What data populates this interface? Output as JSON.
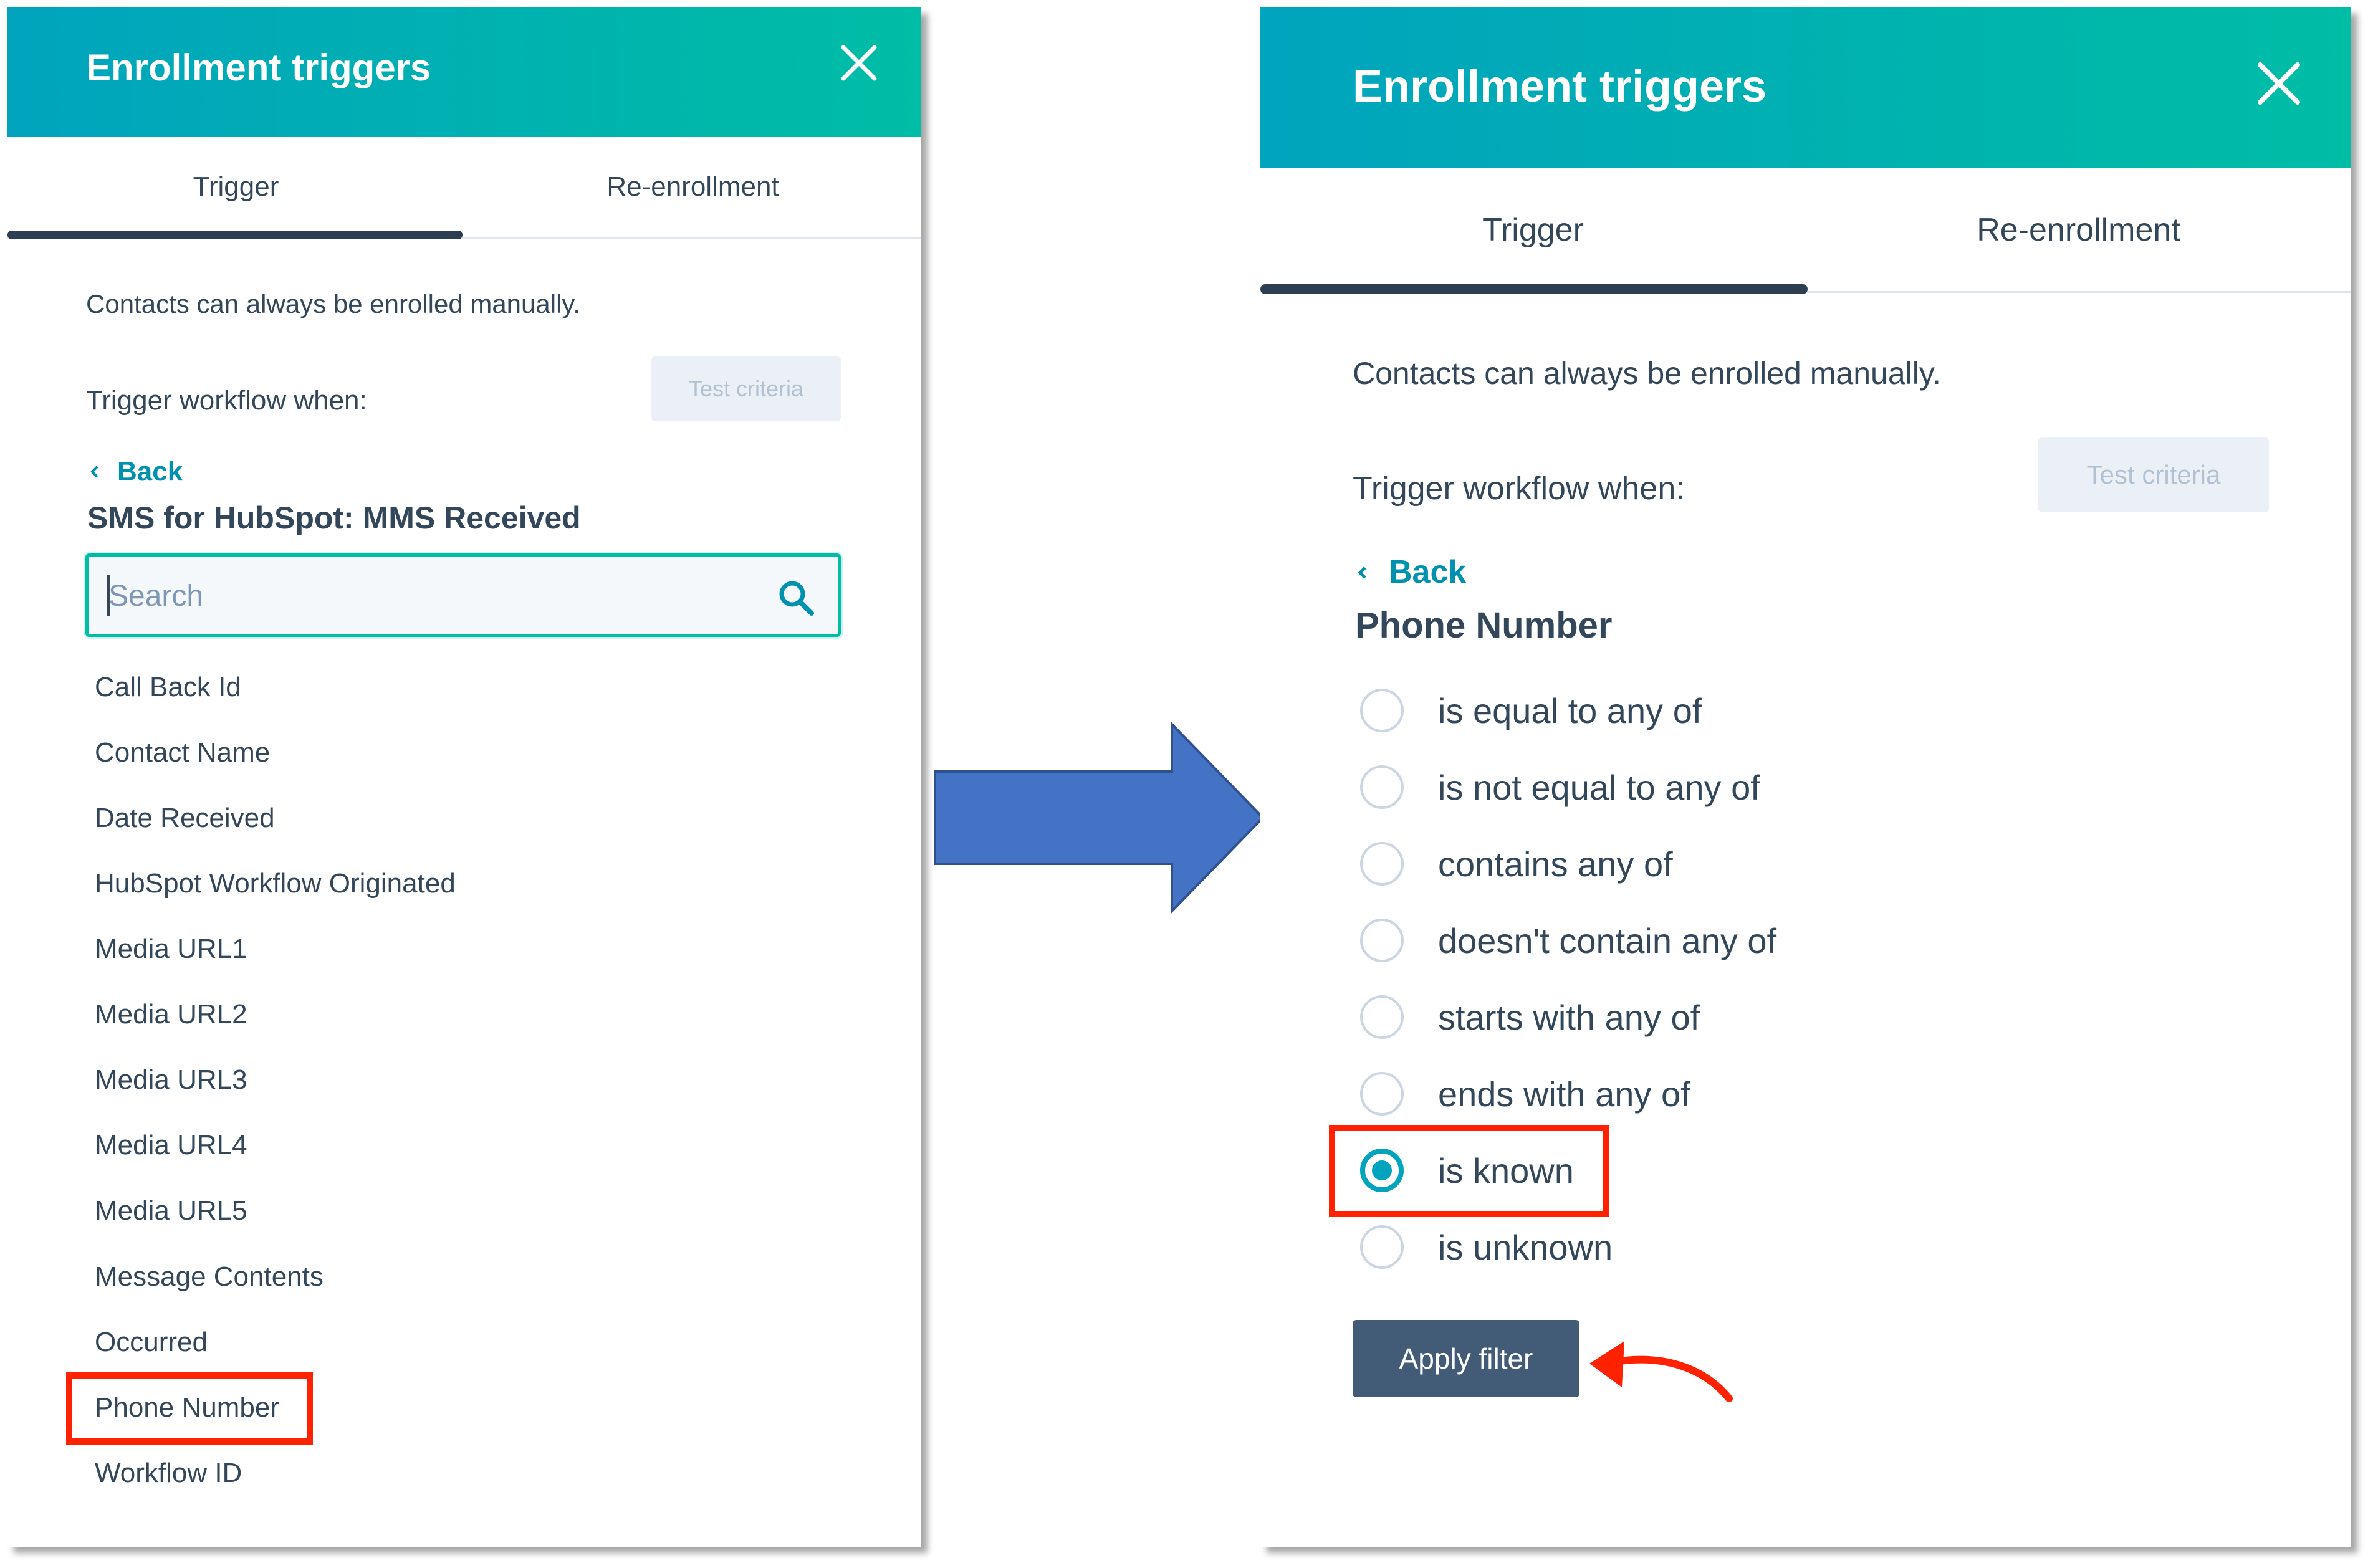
{
  "left_panel": {
    "title": "Enrollment triggers",
    "tabs": [
      {
        "label": "Trigger",
        "active": true
      },
      {
        "label": "Re-enrollment",
        "active": false
      }
    ],
    "info_text": "Contacts can always be enrolled manually.",
    "trigger_label": "Trigger workflow when:",
    "test_button": "Test criteria",
    "back_label": "Back",
    "section_title": "SMS for HubSpot: MMS Received",
    "search": {
      "placeholder": "Search",
      "value": ""
    },
    "properties": [
      "Call Back Id",
      "Contact Name",
      "Date Received",
      "HubSpot Workflow Originated",
      "Media URL1",
      "Media URL2",
      "Media URL3",
      "Media URL4",
      "Media URL5",
      "Message Contents",
      "Occurred",
      "Phone Number",
      "Workflow ID"
    ],
    "highlighted_property": "Phone Number"
  },
  "right_panel": {
    "title": "Enrollment triggers",
    "tabs": [
      {
        "label": "Trigger",
        "active": true
      },
      {
        "label": "Re-enrollment",
        "active": false
      }
    ],
    "info_text": "Contacts can always be enrolled manually.",
    "trigger_label": "Trigger workflow when:",
    "test_button": "Test criteria",
    "back_label": "Back",
    "section_title": "Phone Number",
    "operators": [
      {
        "label": "is equal to any of",
        "selected": false
      },
      {
        "label": "is not equal to any of",
        "selected": false
      },
      {
        "label": "contains any of",
        "selected": false
      },
      {
        "label": "doesn't contain any of",
        "selected": false
      },
      {
        "label": "starts with any of",
        "selected": false
      },
      {
        "label": "ends with any of",
        "selected": false
      },
      {
        "label": "is known",
        "selected": true
      },
      {
        "label": "is unknown",
        "selected": false
      }
    ],
    "apply_button": "Apply filter"
  },
  "icons": {
    "close": "close-icon",
    "search": "search-icon",
    "back": "chevron-left-icon"
  },
  "colors": {
    "header_gradient_start": "#00a4bd",
    "header_gradient_end": "#00bda5",
    "link": "#0091ae",
    "text": "#33475b",
    "tab_underline": "#2d3e50",
    "radio_selected": "#00a4bd",
    "apply_button": "#425b76",
    "annotation_red": "#ff2200",
    "big_arrow": "#4472c4"
  }
}
